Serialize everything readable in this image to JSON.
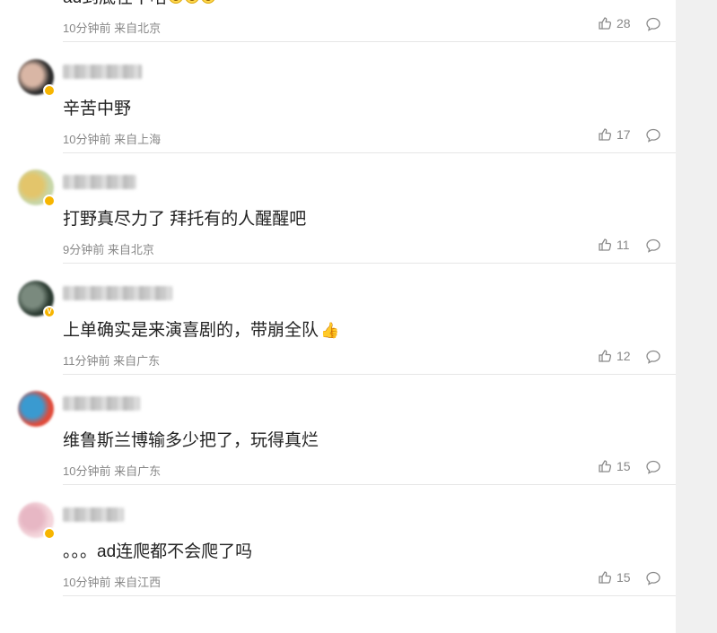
{
  "comments": [
    {
      "text": "ad到底在干啥",
      "emoji_count": 3,
      "meta": "10分钟前 来自北京",
      "likes": "28",
      "avatar_colors": [
        "#d8dde6",
        "#b9c2cf"
      ],
      "badge": false,
      "username_width": 0
    },
    {
      "text": "辛苦中野",
      "meta": "10分钟前 来自上海",
      "likes": "17",
      "avatar_colors": [
        "#2b2b2b",
        "#d9b6a5"
      ],
      "badge": true,
      "badge_mark": "",
      "username_width": 88
    },
    {
      "text": "打野真尽力了 拜托有的人醒醒吧",
      "meta": "9分钟前 来自北京",
      "likes": "11",
      "avatar_colors": [
        "#c7d6a8",
        "#e3c56b"
      ],
      "badge": true,
      "badge_mark": "",
      "username_width": 82
    },
    {
      "text": "上单确实是来演喜剧的，带崩全队",
      "thumb_emoji": true,
      "meta": "11分钟前 来自广东",
      "likes": "12",
      "avatar_colors": [
        "#2a3a30",
        "#7a8a7e"
      ],
      "badge": true,
      "badge_mark": "V",
      "username_width": 122
    },
    {
      "text": "维鲁斯兰博输多少把了，玩得真烂",
      "meta": "10分钟前 来自广东",
      "likes": "15",
      "avatar_colors": [
        "#e04a3a",
        "#3a9ad0"
      ],
      "badge": false,
      "username_width": 86
    },
    {
      "text": "。。。ad连爬都不会爬了吗",
      "meta": "10分钟前 来自江西",
      "likes": "15",
      "avatar_colors": [
        "#f4d6dc",
        "#e7b7c4"
      ],
      "badge": true,
      "badge_mark": "",
      "username_width": 68
    }
  ],
  "icons": {
    "like": "thumbs-up-icon",
    "reply": "comment-bubble-icon"
  }
}
